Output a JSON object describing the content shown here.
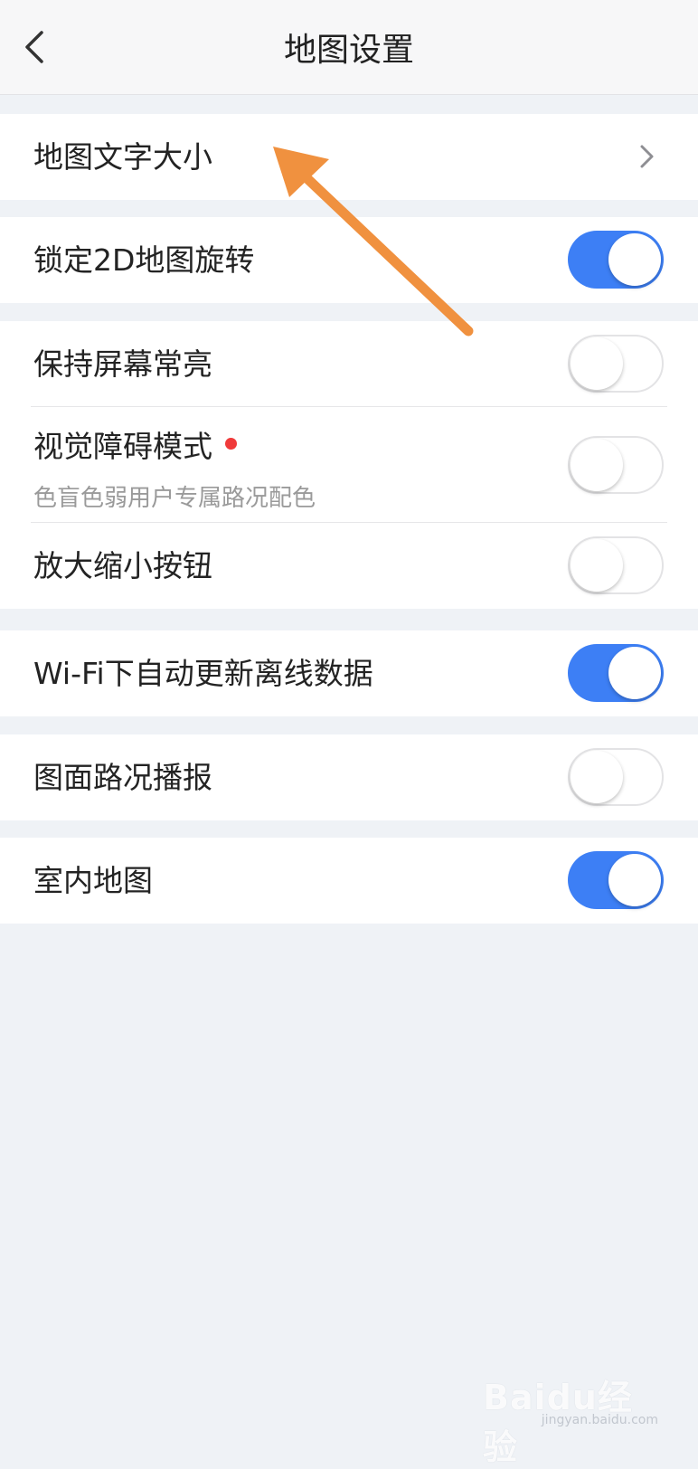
{
  "header": {
    "title": "地图设置",
    "back_icon": "chevron-left-icon"
  },
  "groups": [
    {
      "items": [
        {
          "label": "地图文字大小",
          "control": "chevron",
          "icon": "chevron-right-icon"
        }
      ]
    },
    {
      "items": [
        {
          "label": "锁定2D地图旋转",
          "control": "toggle",
          "on": true
        }
      ]
    },
    {
      "items": [
        {
          "label": "保持屏幕常亮",
          "control": "toggle",
          "on": false
        },
        {
          "label": "视觉障碍模式",
          "sublabel": "色盲色弱用户专属路况配色",
          "badge": "red-dot",
          "control": "toggle",
          "on": false
        },
        {
          "label": "放大缩小按钮",
          "control": "toggle",
          "on": false
        }
      ]
    },
    {
      "items": [
        {
          "label": "Wi-Fi下自动更新离线数据",
          "control": "toggle",
          "on": true
        }
      ]
    },
    {
      "items": [
        {
          "label": "图面路况播报",
          "control": "toggle",
          "on": false
        }
      ]
    },
    {
      "items": [
        {
          "label": "室内地图",
          "control": "toggle",
          "on": true
        }
      ]
    }
  ],
  "annotation": {
    "type": "arrow",
    "color": "#f0913f",
    "points_to": "地图文字大小"
  },
  "watermark": {
    "brand": "Baidu经验",
    "url": "jingyan.baidu.com"
  },
  "colors": {
    "toggle_on": "#3d7ff5",
    "background": "#eff2f6",
    "badge": "#f03a3a"
  }
}
